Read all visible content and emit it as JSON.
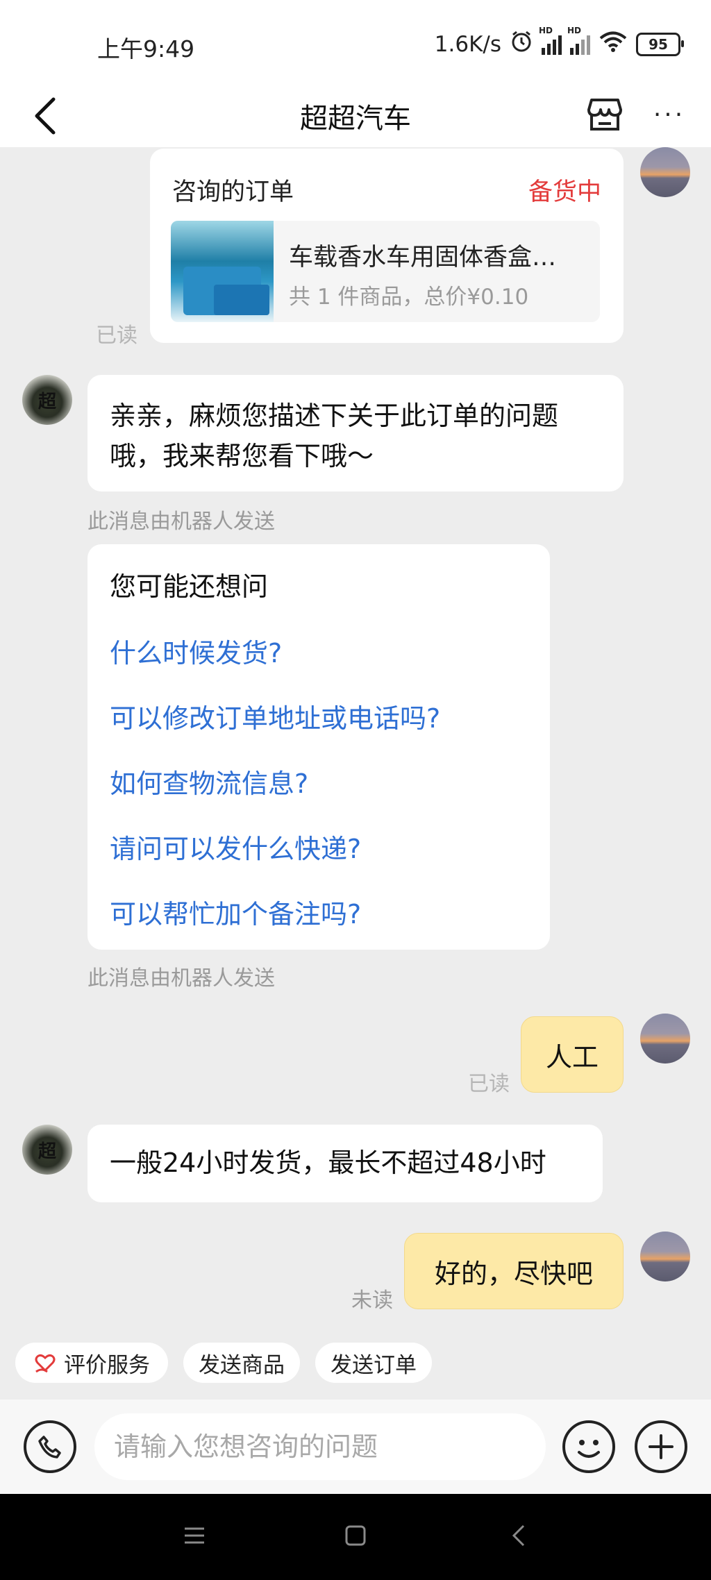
{
  "status_bar": {
    "time": "上午9:49",
    "net_speed": "1.6K/s",
    "battery": "95",
    "hd_label": "HD"
  },
  "header": {
    "title": "超超汽车",
    "more": "···"
  },
  "order_card": {
    "heading": "咨询的订单",
    "status": "备货中",
    "product_name": "车载香水车用固体香盒…",
    "summary": "共 1 件商品，总价¥0.10",
    "read_label": "已读"
  },
  "messages": {
    "bot_avatar_text": "超",
    "bot_greeting": "亲亲，麻烦您描述下关于此订单的问题哦，我来帮您看下哦～",
    "bot_sent_note_1": "此消息由机器人发送",
    "suggest_title": "您可能还想问",
    "suggestions": [
      "什么时候发货?",
      "可以修改订单地址或电话吗?",
      "如何查物流信息?",
      "请问可以发什么快递?",
      "可以帮忙加个备注吗?"
    ],
    "bot_sent_note_2": "此消息由机器人发送",
    "user_msg_1": "人工",
    "user_msg_1_status": "已读",
    "seller_reply": "一般24小时发货，最长不超过48小时",
    "user_msg_2": "好的，尽快吧",
    "user_msg_2_status": "未读"
  },
  "quick_actions": {
    "rate": "评价服务",
    "send_product": "发送商品",
    "send_order": "发送订单"
  },
  "input": {
    "placeholder": "请输入您想咨询的问题"
  }
}
